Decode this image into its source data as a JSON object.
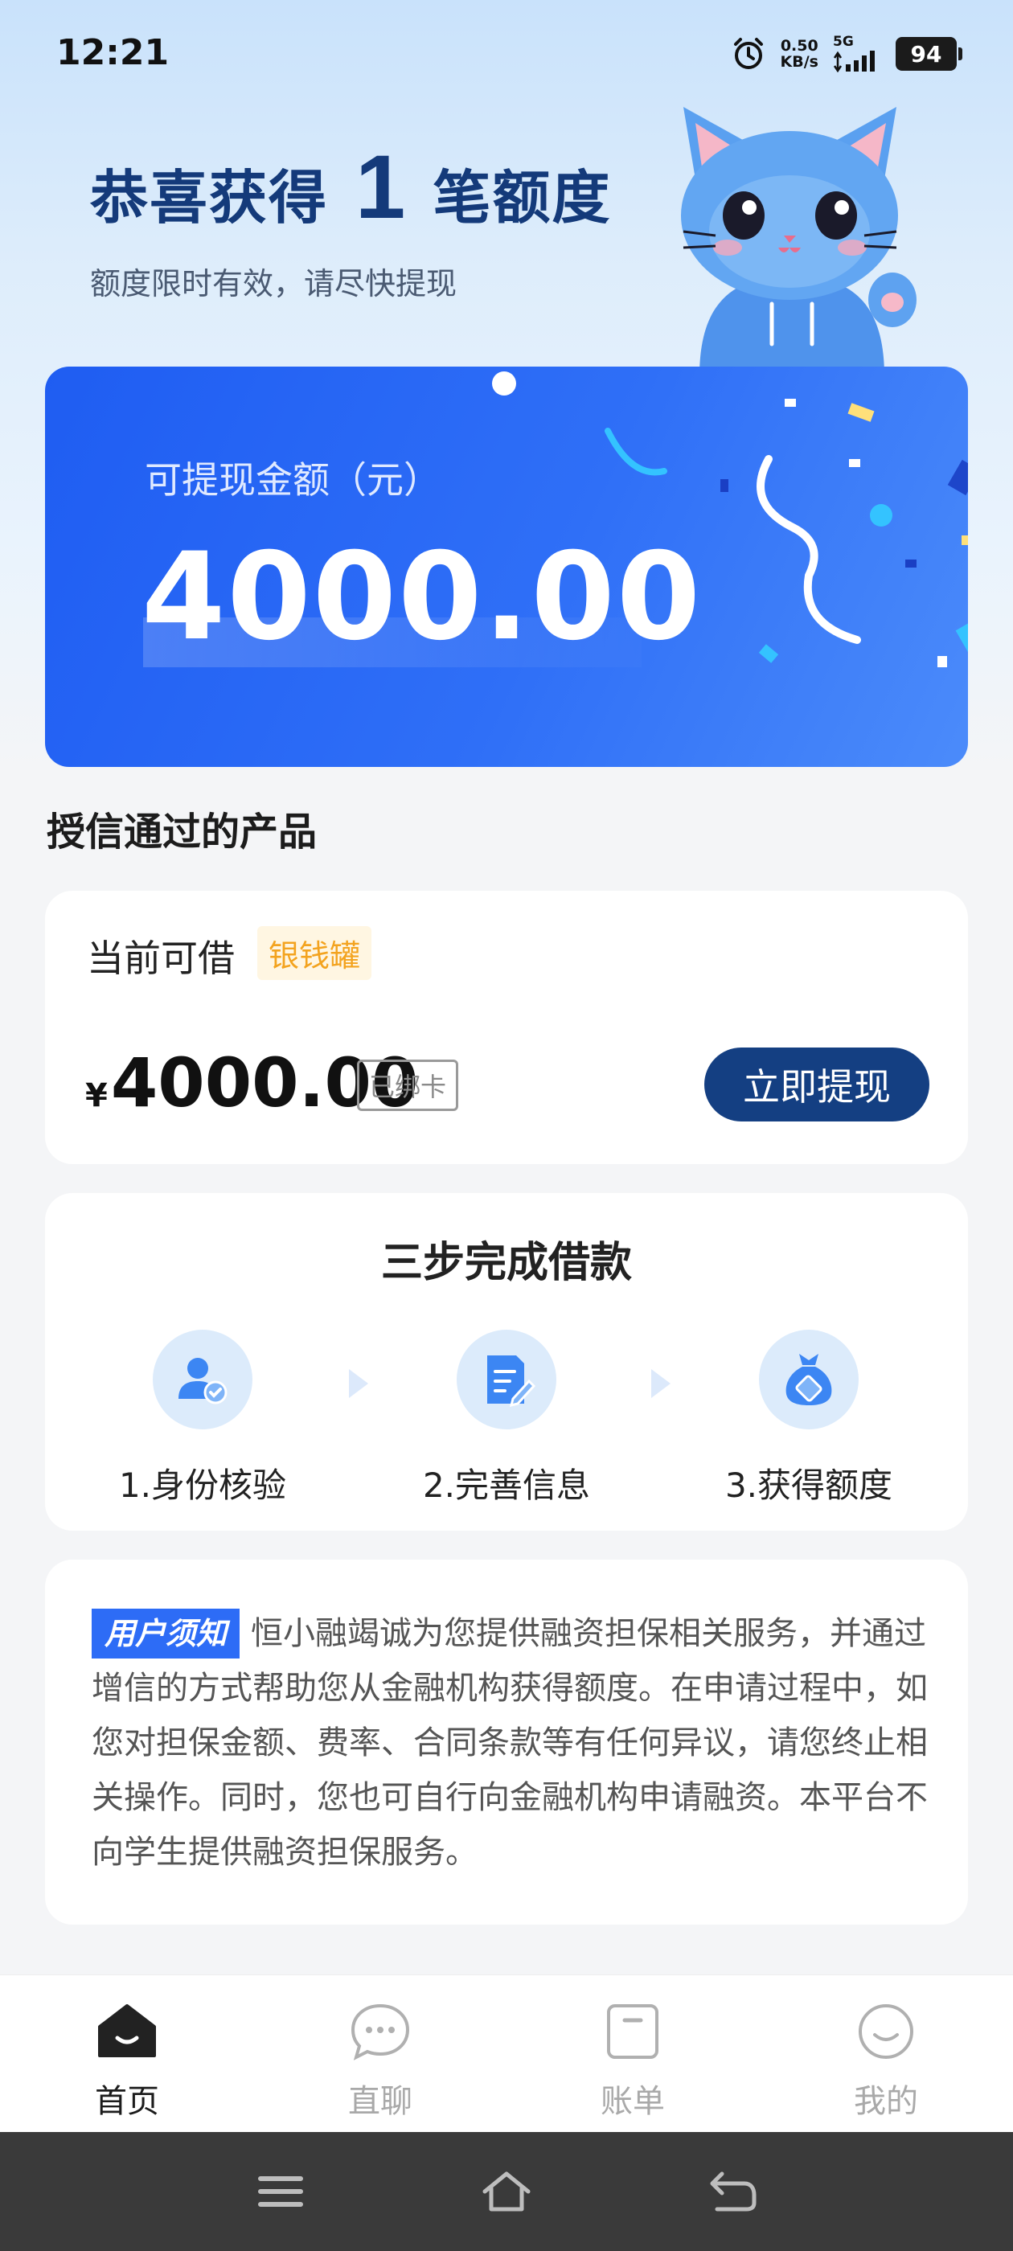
{
  "status_bar": {
    "time": "12:21",
    "net_speed_value": "0.50",
    "net_speed_unit": "KB/s",
    "network_type": "5G",
    "battery": "94"
  },
  "hero": {
    "title_prefix": "恭喜获得",
    "title_count": "1",
    "title_suffix": "笔额度",
    "subtitle": "额度限时有效，请尽快提现"
  },
  "amount_card": {
    "label": "可提现金额（元）",
    "amount": "4000.00"
  },
  "section_title": "授信通过的产品",
  "product": {
    "label": "当前可借",
    "tag": "银钱罐",
    "currency": "¥",
    "amount": "4000.00",
    "card_status": "已绑卡",
    "button": "立即提现"
  },
  "steps": {
    "title": "三步完成借款",
    "items": [
      {
        "label": "1.身份核验",
        "icon": "user-verify-icon"
      },
      {
        "label": "2.完善信息",
        "icon": "document-edit-icon"
      },
      {
        "label": "3.获得额度",
        "icon": "money-bag-icon"
      }
    ]
  },
  "notice": {
    "tag": "用户须知",
    "text": "恒小融竭诚为您提供融资担保相关服务，并通过增信的方式帮助您从金融机构获得额度。在申请过程中，如您对担保金额、费率、合同条款等有任何异议，请您终止相关操作。同时，您也可自行向金融机构申请融资。本平台不向学生提供融资担保服务。"
  },
  "tabs": [
    {
      "label": "首页",
      "icon": "home-icon",
      "active": true
    },
    {
      "label": "直聊",
      "icon": "chat-icon",
      "active": false
    },
    {
      "label": "账单",
      "icon": "bill-icon",
      "active": false
    },
    {
      "label": "我的",
      "icon": "profile-icon",
      "active": false
    }
  ],
  "colors": {
    "primary_blue": "#2f6ff7",
    "navy": "#143f82",
    "tag_orange": "#f3a31f"
  }
}
